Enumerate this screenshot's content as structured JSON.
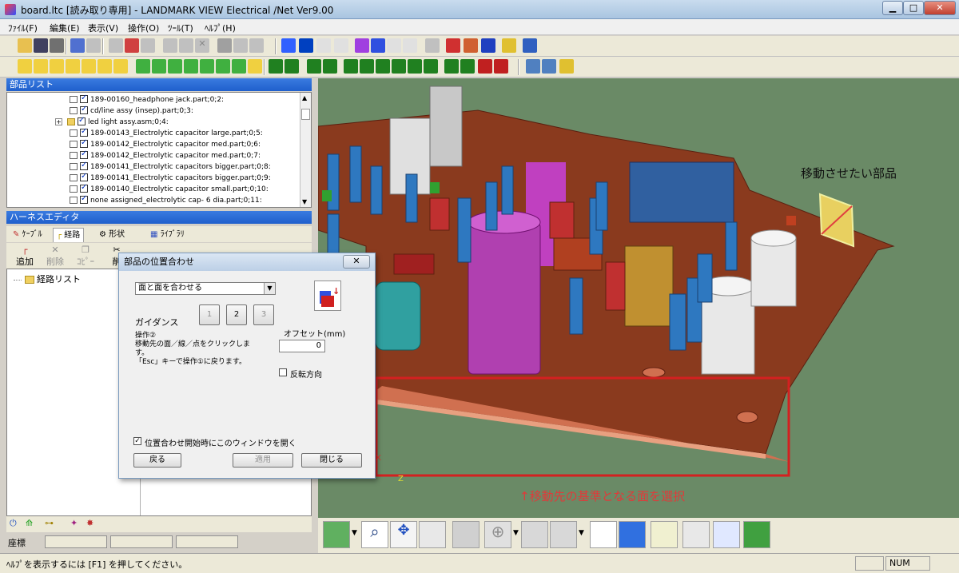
{
  "window": {
    "title": "board.ltc [読み取り専用] - LANDMARK VIEW Electrical /Net Ver9.00"
  },
  "menu": [
    "ﾌｧｲﾙ(F)",
    "編集(E)",
    "表示(V)",
    "操作(O)",
    "ﾂｰﾙ(T)",
    "ﾍﾙﾌﾟ(H)"
  ],
  "parts_panel": {
    "title": "部品リスト",
    "items": [
      "189-00160_headphone jack.part;0;2:",
      "cd/line assy  (insep).part;0;3:",
      "led light assy.asm;0;4:",
      "189-00143_Electrolytic capacitor large.part;0;5:",
      "189-00142_Electrolytic capacitor med.part;0;6:",
      "189-00142_Electrolytic capacitor med.part;0;7:",
      "189-00141_Electrolytic capacitors bigger.part;0;8:",
      "189-00141_Electrolytic capacitors bigger.part;0;9:",
      "189-00140_Electrolytic capacitor small.part;0;10:",
      "none assigned_electrolytic  cap- 6 dia.part;0;11:"
    ]
  },
  "harness": {
    "title": "ハーネスエディタ",
    "tabs": [
      "ｹｰﾌﾞﾙ",
      "経路",
      "形状",
      "ﾗｲﾌﾞﾗﾘ"
    ],
    "tools": [
      "追加",
      "削除",
      "ｺﾋﾟｰ",
      "削"
    ],
    "tree_root": "経路リスト"
  },
  "coord_label": "座標",
  "status": {
    "help": "ﾍﾙﾌﾟを表示するには [F1] を押してください。",
    "num": "NUM"
  },
  "dialog": {
    "title": "部品の位置合わせ",
    "mode": "面と面を合わせる",
    "guidance_label": "ガイダンス",
    "steps": [
      "1",
      "2",
      "3"
    ],
    "guidance_text_1": "操作②",
    "guidance_text_2": "移動先の面／線／点をクリックしま",
    "guidance_text_3": "す。",
    "guidance_text_4": "「Esc」キーで操作①に戻ります。",
    "offset_label": "オフセット(mm)",
    "offset_value": "0",
    "reverse_label": "反転方向",
    "open_on_start_label": "位置合わせ開始時にこのウィンドウを開く",
    "back": "戻る",
    "apply": "適用",
    "close": "閉じる"
  },
  "annotations": {
    "move_target": "移動させたい部品",
    "select_face": "↑移動先の基準となる面を選択"
  },
  "axis": {
    "x": "X",
    "z": "Z"
  },
  "colors": {
    "board": "#8a3a1e",
    "viewport_bg": "#6a8a66",
    "annot": "#e03a3a",
    "select_frame": "#d42020"
  }
}
